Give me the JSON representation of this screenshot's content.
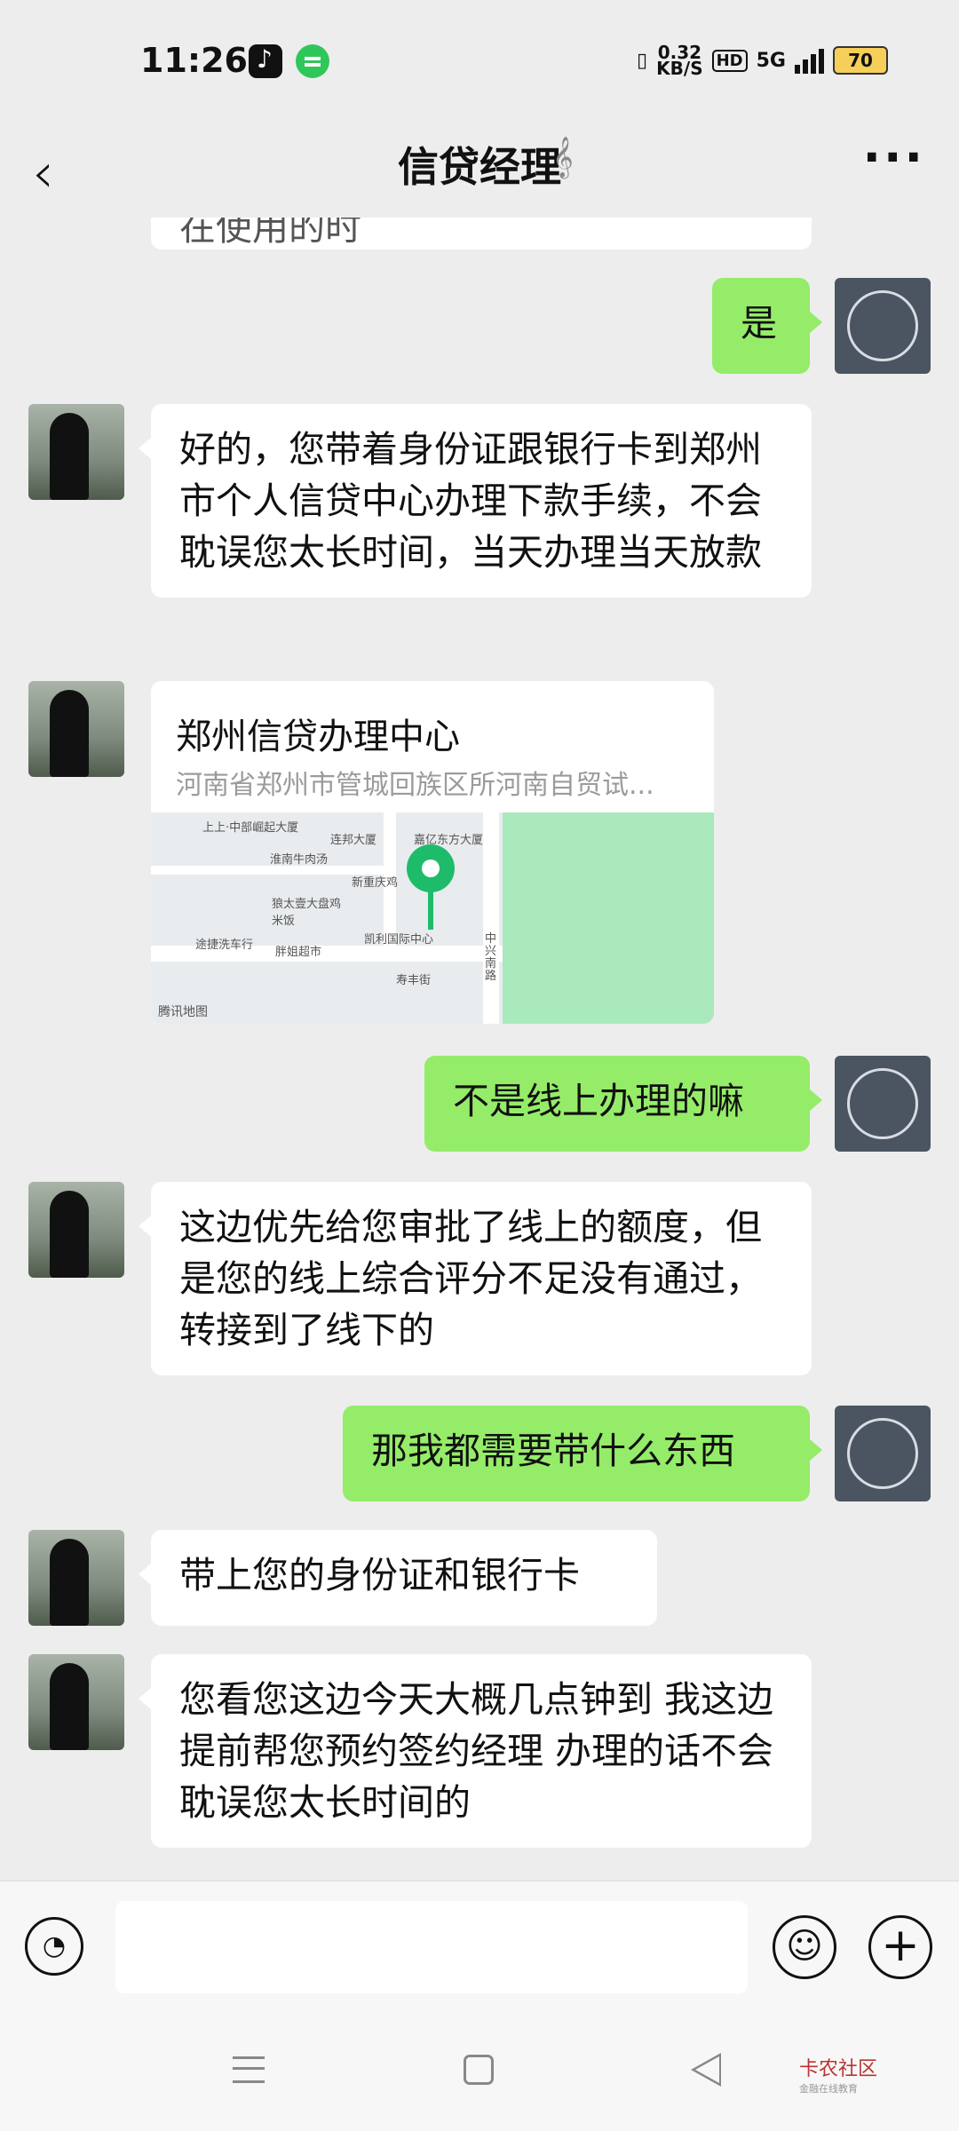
{
  "status": {
    "time": "11:26",
    "speed_value": "0.32",
    "speed_unit": "KB/S",
    "hd": "HD",
    "network": "5G",
    "battery": "70"
  },
  "nav": {
    "title": "信贷经理"
  },
  "messages": [
    {
      "side": "left",
      "text": "在使用的时"
    },
    {
      "side": "right",
      "text": "是"
    },
    {
      "side": "left",
      "text": "好的，您带着身份证跟银行卡到郑州市个人信贷中心办理下款手续，不会耽误您太长时间，当天办理当天放款"
    },
    {
      "side": "left",
      "type": "location",
      "name": "郑州信贷办理中心",
      "address": "河南省郑州市管城回族区所河南自贸试..."
    },
    {
      "side": "right",
      "text": "不是线上办理的嘛"
    },
    {
      "side": "left",
      "text": "这边优先给您审批了线上的额度，但是您的线上综合评分不足没有通过，转接到了线下的"
    },
    {
      "side": "right",
      "text": "那我都需要带什么东西"
    },
    {
      "side": "left",
      "text": "带上您的身份证和银行卡"
    },
    {
      "side": "left",
      "text": "您看您这边今天大概几点钟到 我这边提前帮您预约签约经理 办理的话不会耽误您太长时间的"
    }
  ],
  "map_labels": {
    "brand": "腾讯地图",
    "a": "上上·中部崛起大厦",
    "b": "连邦大厦",
    "c": "嘉亿东方大厦",
    "d": "淮南牛肉汤",
    "e": "新重庆鸡",
    "f": "狼太壹大盘鸡米饭",
    "g": "凯利国际中心",
    "h": "途捷洗车行",
    "i": "胖姐超市",
    "j": "寿丰街",
    "k": "中兴南路"
  },
  "watermark": {
    "title": "卡农社区",
    "sub": "金融在线教育"
  }
}
